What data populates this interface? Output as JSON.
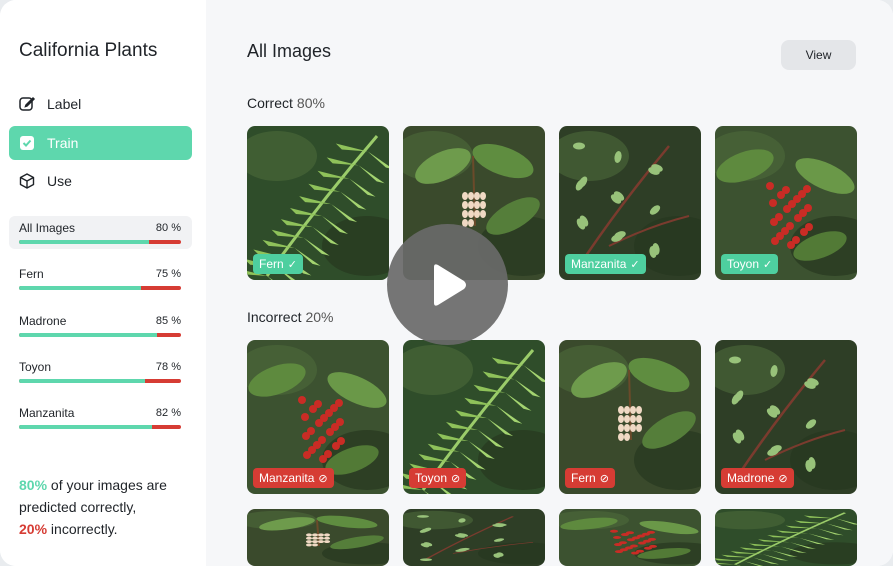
{
  "sidebar": {
    "title": "California Plants",
    "nav": [
      {
        "label": "Label",
        "icon": "pencil-icon"
      },
      {
        "label": "Train",
        "icon": "checkbox-icon",
        "active": true
      },
      {
        "label": "Use",
        "icon": "cube-icon"
      }
    ],
    "stats": [
      {
        "name": "All Images",
        "pct_label": "80 %",
        "fraction": 0.8
      },
      {
        "name": "Fern",
        "pct_label": "75 %",
        "fraction": 0.75
      },
      {
        "name": "Madrone",
        "pct_label": "85 %",
        "fraction": 0.85
      },
      {
        "name": "Toyon",
        "pct_label": "78 %",
        "fraction": 0.78
      },
      {
        "name": "Manzanita",
        "pct_label": "82 %",
        "fraction": 0.82
      }
    ],
    "summary": {
      "good_pct": "80%",
      "good_text": " of your images are predicted correctly,",
      "bad_pct": "20%",
      "bad_text": " incorrectly."
    }
  },
  "main": {
    "title": "All Images",
    "view_label": "View",
    "correct": {
      "label": "Correct",
      "pct": "80%"
    },
    "incorrect": {
      "label": "Incorrect",
      "pct": "20%"
    },
    "correct_tiles": [
      {
        "label": "Fern",
        "status": "correct",
        "plant": "fern"
      },
      {
        "label": "",
        "status": "correct",
        "plant": "madrone"
      },
      {
        "label": "Manzanita",
        "status": "correct",
        "plant": "manzanita"
      },
      {
        "label": "Toyon",
        "status": "correct",
        "plant": "toyon"
      }
    ],
    "incorrect_tiles": [
      {
        "label": "Manzanita",
        "status": "incorrect",
        "plant": "toyon"
      },
      {
        "label": "Toyon",
        "status": "incorrect",
        "plant": "fern"
      },
      {
        "label": "Fern",
        "status": "incorrect",
        "plant": "madrone"
      },
      {
        "label": "Madrone",
        "status": "incorrect",
        "plant": "manzanita"
      }
    ],
    "partial_tiles": [
      {
        "plant": "madrone"
      },
      {
        "plant": "manzanita"
      },
      {
        "plant": "toyon"
      },
      {
        "plant": "fern"
      }
    ]
  },
  "colors": {
    "accent": "#5ed7ad",
    "error": "#d63c34",
    "main_bg": "#f6f7f9"
  },
  "overlay": {
    "icon": "play-icon"
  }
}
